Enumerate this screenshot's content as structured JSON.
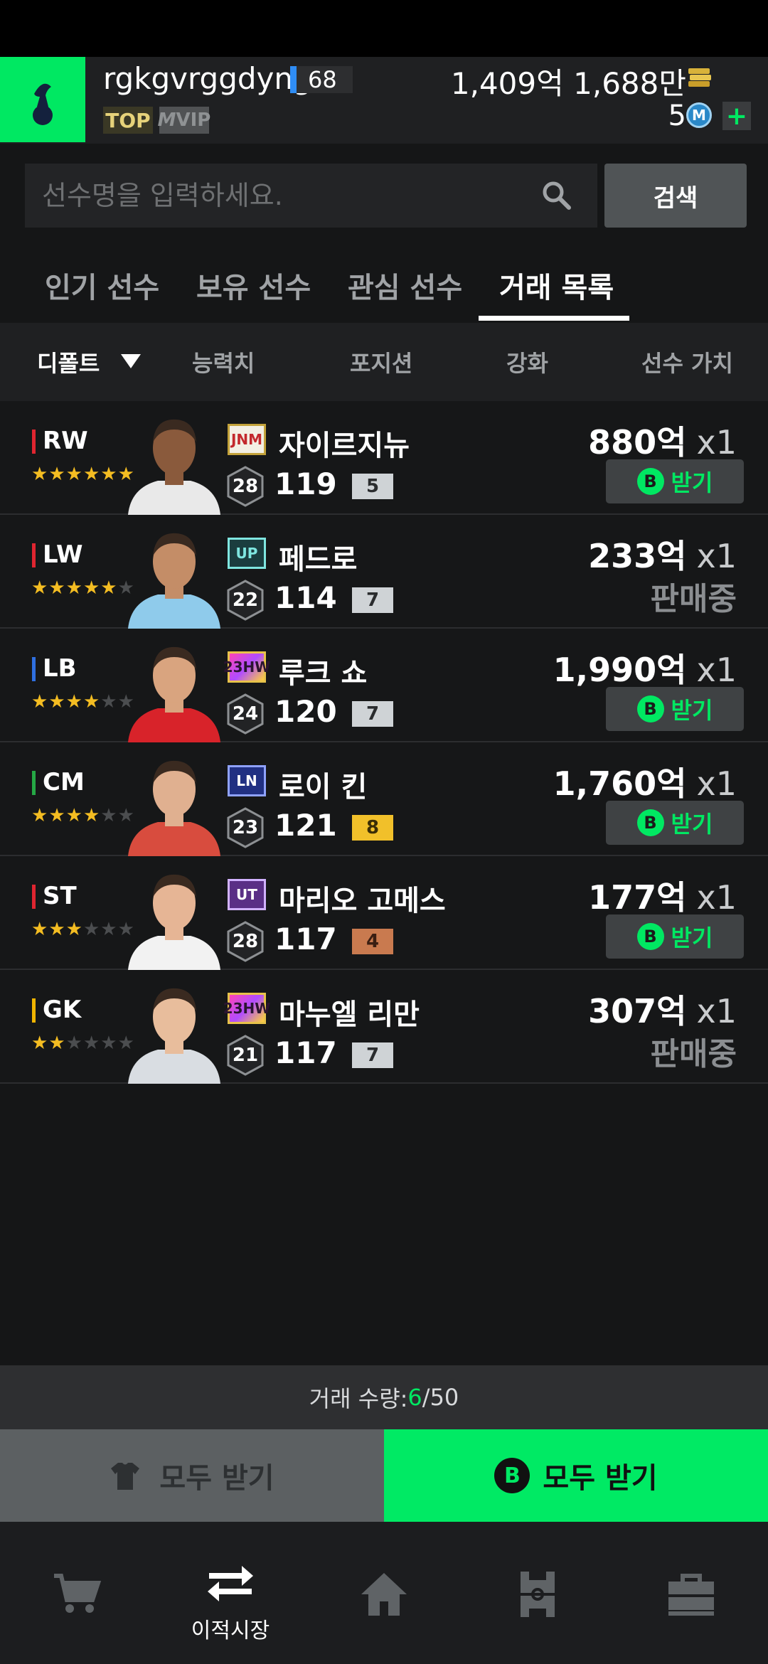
{
  "header": {
    "username": "rgkgvrggdyng",
    "level": "68",
    "badge_top": "TOP",
    "badge_vip": "VIP",
    "badge_vip_m": "M",
    "money": "1,409억 1,688만",
    "m_points": "5",
    "m_icon_letter": "M",
    "plus": "+"
  },
  "search": {
    "placeholder": "선수명을 입력하세요.",
    "button_label": "검색"
  },
  "tabs": [
    {
      "label": "인기 선수"
    },
    {
      "label": "보유 선수"
    },
    {
      "label": "관심 선수"
    },
    {
      "label": "거래 목록",
      "active": true
    }
  ],
  "sort": {
    "items": [
      "디폴트",
      "능력치",
      "포지션",
      "강화",
      "선수 가치"
    ],
    "active": "디폴트"
  },
  "players": [
    {
      "position": "RW",
      "pos_color": "#e02530",
      "stars": 6,
      "season": "JNM",
      "name": "자이르지뉴",
      "pay": "28",
      "ovr": "119",
      "enhance": "5",
      "price": "880억",
      "qty": "x1",
      "status": "받기",
      "action": true
    },
    {
      "position": "LW",
      "pos_color": "#e02530",
      "stars": 5,
      "season": "UP",
      "name": "페드로",
      "pay": "22",
      "ovr": "114",
      "enhance": "7",
      "price": "233억",
      "qty": "x1",
      "status": "판매중",
      "action": false
    },
    {
      "position": "LB",
      "pos_color": "#2f6fe0",
      "stars": 4,
      "season": "23HW",
      "name": "루크 쇼",
      "pay": "24",
      "ovr": "120",
      "enhance": "7",
      "price": "1,990억",
      "qty": "x1",
      "status": "받기",
      "action": true
    },
    {
      "position": "CM",
      "pos_color": "#25a845",
      "stars": 4,
      "season": "LN",
      "name": "로이 킨",
      "pay": "23",
      "ovr": "121",
      "enhance": "8",
      "price": "1,760억",
      "qty": "x1",
      "status": "받기",
      "action": true
    },
    {
      "position": "ST",
      "pos_color": "#e02530",
      "stars": 3,
      "season": "UT",
      "name": "마리오 고메스",
      "pay": "28",
      "ovr": "117",
      "enhance": "4",
      "price": "177억",
      "qty": "x1",
      "status": "받기",
      "action": true
    },
    {
      "position": "GK",
      "pos_color": "#f0b400",
      "stars": 2,
      "season": "23HW",
      "name": "마누엘 리만",
      "pay": "21",
      "ovr": "117",
      "enhance": "7",
      "price": "307억",
      "qty": "x1",
      "status": "판매중",
      "action": false
    }
  ],
  "b_letter": "B",
  "trade_count": {
    "label": "거래 수량: ",
    "current": "6",
    "max": "/50"
  },
  "bottom_buttons": {
    "left_label": "모두 받기",
    "right_label": "모두 받기"
  },
  "nav": {
    "items": [
      {
        "icon": "cart-icon",
        "label": ""
      },
      {
        "icon": "transfer-icon",
        "label": "이적시장"
      },
      {
        "icon": "home-icon",
        "label": ""
      },
      {
        "icon": "squad-icon",
        "label": ""
      },
      {
        "icon": "store-icon",
        "label": ""
      }
    ]
  },
  "colors": {
    "accent": "#00e862",
    "background": "#151617"
  }
}
